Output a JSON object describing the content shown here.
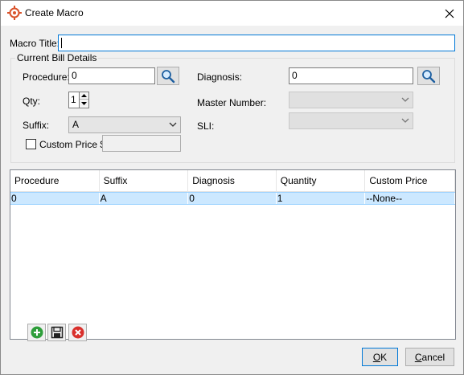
{
  "window": {
    "title": "Create Macro",
    "close_glyph": "✕"
  },
  "form": {
    "macro_title_label": "Macro Title:",
    "macro_title_value": "",
    "group_title": "Current Bill Details",
    "procedure_label": "Procedure:",
    "procedure_value": "0",
    "qty_label": "Qty:",
    "qty_value": "1",
    "suffix_label": "Suffix:",
    "suffix_value": "A",
    "custom_price_label": "Custom Price $",
    "custom_price_checked": false,
    "custom_price_value": "",
    "diagnosis_label": "Diagnosis:",
    "diagnosis_value": "0",
    "master_number_label": "Master Number:",
    "master_number_value": "",
    "sli_label": "SLI:",
    "sli_value": ""
  },
  "grid": {
    "columns": [
      "Procedure",
      "Suffix",
      "Diagnosis",
      "Quantity",
      "Custom Price"
    ],
    "rows": [
      [
        "0",
        "A",
        "0",
        "1",
        "--None--"
      ]
    ]
  },
  "toolbar": {
    "add_icon": "add-icon",
    "save_icon": "save-icon",
    "delete_icon": "delete-icon"
  },
  "buttons": {
    "ok_accel": "O",
    "ok_rest": "K",
    "cancel_accel": "C",
    "cancel_rest": "ancel"
  },
  "colors": {
    "selection": "#cce8ff",
    "search_icon": "#1e5fa0",
    "add_green": "#2e9e3a",
    "delete_red": "#d9302c",
    "app_icon": "#d9532b"
  }
}
